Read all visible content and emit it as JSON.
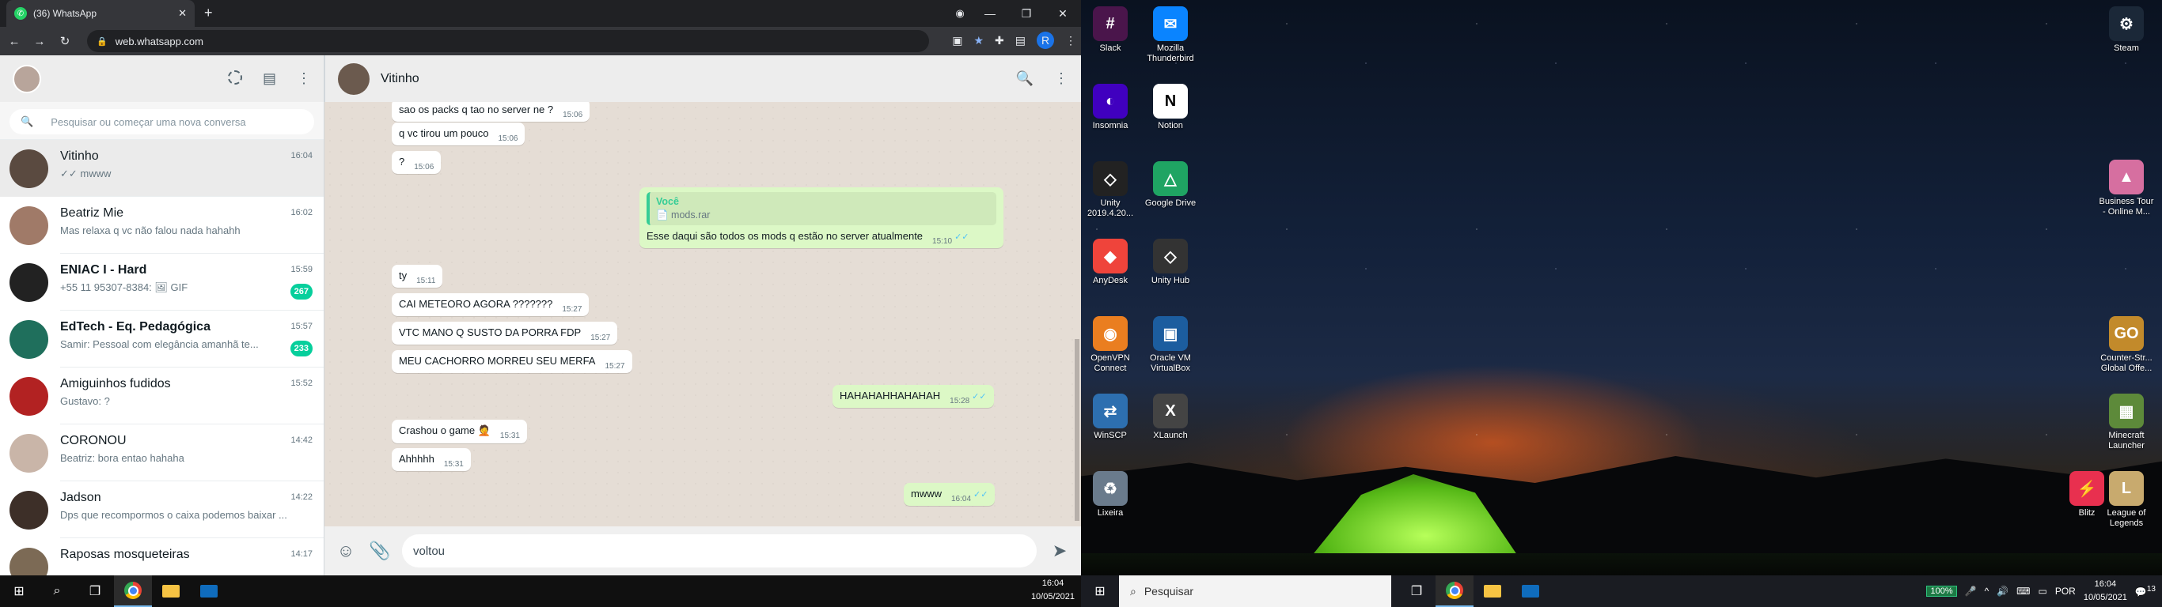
{
  "browser": {
    "tab_title": "(36) WhatsApp",
    "tab_close": "✕",
    "new_tab": "+",
    "url": "web.whatsapp.com",
    "profile_initial": "R"
  },
  "sidebar": {
    "search_placeholder": "Pesquisar ou começar uma nova conversa",
    "chats": [
      {
        "name": "Vitinho",
        "time": "16:04",
        "preview": "✓✓ mwww",
        "unread": "",
        "avatar_color": "#5a4a40"
      },
      {
        "name": "Beatriz Mie",
        "time": "16:02",
        "preview": "Mas relaxa q vc não falou nada hahahh",
        "unread": "",
        "avatar_color": "#a07a68"
      },
      {
        "name": "ENIAC I - Hard",
        "time": "15:59",
        "preview": "+55 11 95307-8384: 🖼 GIF",
        "unread": "267",
        "avatar_color": "#222222"
      },
      {
        "name": "EdTech - Eq. Pedagógica",
        "time": "15:57",
        "preview": "Samir: Pessoal com elegância amanhã te...",
        "unread": "233",
        "avatar_color": "#1f6f5c"
      },
      {
        "name": "Amiguinhos fudidos",
        "time": "15:52",
        "preview": "Gustavo: ?",
        "unread": "",
        "avatar_color": "#b22222"
      },
      {
        "name": "CORONOU",
        "time": "14:42",
        "preview": "Beatriz: bora entao hahaha",
        "unread": "",
        "avatar_color": "#c9b5a8"
      },
      {
        "name": "Jadson",
        "time": "14:22",
        "preview": "Dps que recompormos o caixa podemos baixar ...",
        "unread": "",
        "avatar_color": "#3d2f28"
      },
      {
        "name": "Raposas mosqueteiras",
        "time": "14:17",
        "preview": "",
        "unread": "",
        "avatar_color": "#7c6a55"
      }
    ]
  },
  "conversation": {
    "contact_name": "Vitinho",
    "messages": [
      {
        "text": "sao os packs q tao no server ne ?",
        "time": "15:06",
        "direction": "in"
      },
      {
        "text": "q vc tirou um pouco",
        "time": "15:06",
        "direction": "in"
      },
      {
        "text": "?",
        "time": "15:06",
        "direction": "in"
      },
      {
        "text": "Esse daqui são todos os mods q estão no server atualmente",
        "time": "15:10",
        "direction": "out",
        "quote_author": "Você",
        "quote_file": "📄 mods.rar"
      },
      {
        "text": "ty",
        "time": "15:11",
        "direction": "in"
      },
      {
        "text": "CAI METEORO AGORA ???????",
        "time": "15:27",
        "direction": "in"
      },
      {
        "text": "VTC MANO Q SUSTO DA PORRA FDP",
        "time": "15:27",
        "direction": "in"
      },
      {
        "text": "MEU CACHORRO MORREU SEU MERFA",
        "time": "15:27",
        "direction": "in"
      },
      {
        "text": "HAHAHAHHAHAHAH",
        "time": "15:28",
        "direction": "out"
      },
      {
        "text": "Crashou o game 🤦",
        "time": "15:31",
        "direction": "in"
      },
      {
        "text": "Ahhhhh",
        "time": "15:31",
        "direction": "in"
      },
      {
        "text": "mwww",
        "time": "16:04",
        "direction": "out"
      }
    ],
    "compose_value": "voltou"
  },
  "left_taskbar": {
    "time": "16:04",
    "date": "10/05/2021"
  },
  "desktop": {
    "icons": [
      {
        "label": "Slack",
        "color": "#4a154b",
        "glyph": "#"
      },
      {
        "label": "Mozilla Thunderbird",
        "color": "#0a84ff",
        "glyph": "✉"
      },
      {
        "label": "Insomnia",
        "color": "#4000bf",
        "glyph": "◐"
      },
      {
        "label": "Notion",
        "color": "#ffffff",
        "glyph": "N"
      },
      {
        "label": "Unity 2019.4.20...",
        "color": "#222222",
        "glyph": "◇"
      },
      {
        "label": "Google Drive",
        "color": "#1fa463",
        "glyph": "△"
      },
      {
        "label": "AnyDesk",
        "color": "#ef443b",
        "glyph": "◆"
      },
      {
        "label": "Unity Hub",
        "color": "#333333",
        "glyph": "◇"
      },
      {
        "label": "OpenVPN Connect",
        "color": "#ea7e20",
        "glyph": "◉"
      },
      {
        "label": "Oracle VM VirtualBox",
        "color": "#1c5d9f",
        "glyph": "▣"
      },
      {
        "label": "WinSCP",
        "color": "#2d6fb0",
        "glyph": "⇄"
      },
      {
        "label": "XLaunch",
        "color": "#444444",
        "glyph": "X"
      },
      {
        "label": "Lixeira",
        "color": "#6a7b8c",
        "glyph": "♻"
      },
      {
        "label": "Steam",
        "color": "#1b2838",
        "glyph": "⚙"
      },
      {
        "label": "Business Tour - Online M...",
        "color": "#d66fa0",
        "glyph": "▲"
      },
      {
        "label": "Counter-Str... Global Offe...",
        "color": "#c28a2b",
        "glyph": "GO"
      },
      {
        "label": "Minecraft Launcher",
        "color": "#5d8a3a",
        "glyph": "▦"
      },
      {
        "label": "Blitz",
        "color": "#e8304f",
        "glyph": "⚡"
      },
      {
        "label": "League of Legends",
        "color": "#c8aa6e",
        "glyph": "L"
      }
    ]
  },
  "right_taskbar": {
    "search_placeholder": "Pesquisar",
    "battery": "100%",
    "language": "POR",
    "time": "16:04",
    "date": "10/05/2021",
    "notification_count": "13"
  }
}
